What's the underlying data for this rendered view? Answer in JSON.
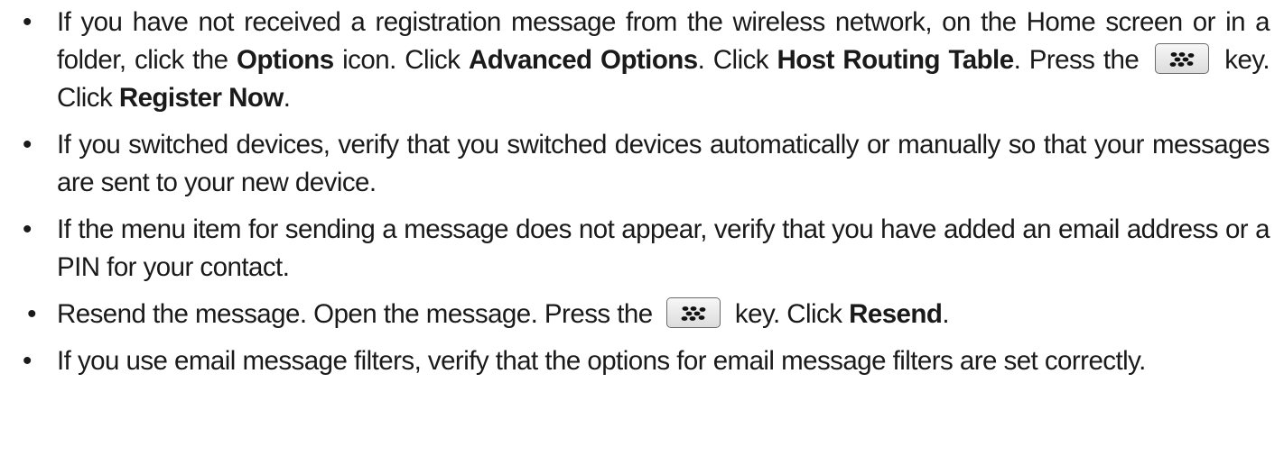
{
  "icons": {
    "bullet": "•",
    "menu_key": "blackberry-menu-key-icon"
  },
  "items": [
    {
      "t1": "If you have not received a registration message from the wireless network, on the Home screen or in a folder, click the ",
      "b1": "Options",
      "t2": " icon. Click ",
      "b2": "Advanced Options",
      "t3": ". Click ",
      "b3": "Host Routing Table",
      "t4": ". Press the ",
      "t5": " key. Click ",
      "b4": "Register Now",
      "t6": "."
    },
    {
      "text": "If you switched devices, verify that you switched devices automatically or manually so that your messages are sent to your new device."
    },
    {
      "text": "If the menu item for sending a message does not appear, verify that you have added an email address or a PIN for your contact."
    },
    {
      "t1": "Resend the message. Open the message. Press the ",
      "t2": " key. Click ",
      "b1": "Resend",
      "t3": "."
    },
    {
      "text": "If you use email message filters, verify that the options for email message filters are set correctly."
    }
  ]
}
